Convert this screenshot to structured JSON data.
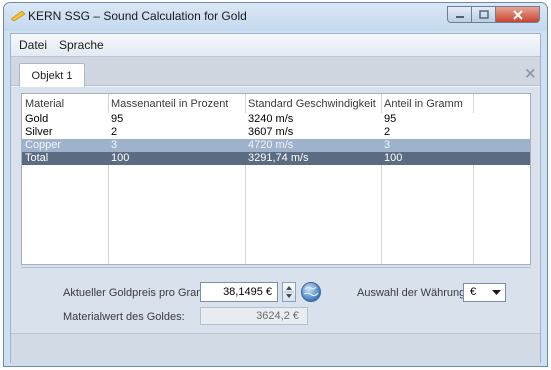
{
  "window": {
    "title": "KERN SSG – Sound Calculation for Gold",
    "app_icon": "ruler-icon",
    "buttons": {
      "minimize": "minimize-icon",
      "maximize": "maximize-icon",
      "close": "close-icon"
    }
  },
  "menu": {
    "items": [
      "Datei",
      "Sprache"
    ]
  },
  "tabs": {
    "active": "Objekt 1",
    "close_symbol": "×"
  },
  "grid": {
    "columns": [
      "Material",
      "Massenanteil in Prozent",
      "Standard Geschwindigkeit",
      "Anteil in Gramm"
    ],
    "rows": [
      [
        "Gold",
        "95",
        "3240 m/s",
        "95"
      ],
      [
        "Silver",
        "2",
        "3607 m/s",
        "2"
      ],
      [
        "Copper",
        "3",
        "4720 m/s",
        "3"
      ],
      [
        "Total",
        "100",
        "3291,74 m/s",
        "100"
      ]
    ],
    "row_colors": [
      "#ffffff",
      "#ffffff",
      "#9eb2cc",
      "#5a6b82"
    ],
    "row_text_colors": [
      "#000000",
      "#000000",
      "#f2f5f9",
      "#ffffff"
    ]
  },
  "form": {
    "gold_price_label": "Aktueller Goldpreis pro Gramm:",
    "gold_price_value": "38,1495 €",
    "material_value_label": "Materialwert des Goldes:",
    "material_value": "3624,2 €",
    "currency_label": "Auswahl der Währung:",
    "currency_value": "€",
    "refresh_icon": "globe-refresh-icon"
  }
}
